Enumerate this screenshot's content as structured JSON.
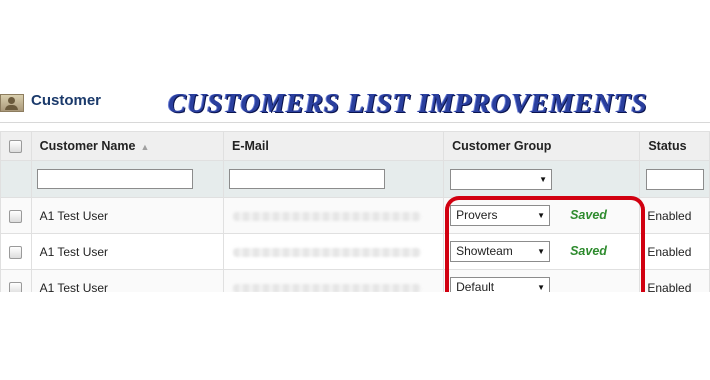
{
  "panel": {
    "title": "Customer",
    "icon": "customer-icon",
    "banner": "CUSTOMERS LIST IMPROVEMENTS"
  },
  "table": {
    "headers": {
      "name": "Customer Name",
      "email": "E-Mail",
      "group": "Customer Group",
      "status": "Status"
    },
    "sort_icon": "sort-ascending-icon",
    "rows": [
      {
        "name": "A1 Test User",
        "group": "Provers",
        "saved": "Saved",
        "status": "Enabled"
      },
      {
        "name": "A1 Test User",
        "group": "Showteam",
        "saved": "Saved",
        "status": "Enabled"
      },
      {
        "name": "A1 Test User",
        "group": "Default",
        "saved": "",
        "status": "Enabled"
      }
    ]
  },
  "colors": {
    "title": "#1b3a6b",
    "banner": "#2a3f9e",
    "saved": "#2e8b2e",
    "highlight": "#d10010"
  }
}
